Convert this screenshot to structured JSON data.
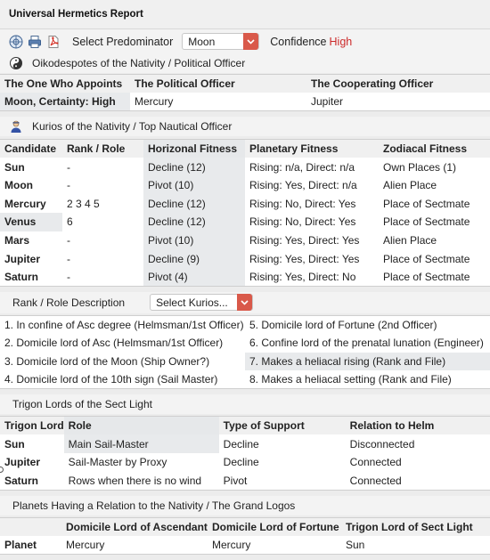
{
  "app": {
    "title": "Universal Hermetics Report"
  },
  "toolbar": {
    "predominator_label": "Select Predominator",
    "predominator_value": "Moon",
    "confidence_label": "Confidence",
    "confidence_value": "High"
  },
  "oikodespotes": {
    "heading": "Oikodespotes of the Nativity / Political Officer",
    "columns": [
      "The One Who Appoints",
      "The Political Officer",
      "The Cooperating Officer"
    ],
    "row": [
      "Moon, Certainty: High",
      "Mercury",
      "Jupiter"
    ]
  },
  "kurios": {
    "heading": "Kurios of the Nativity / Top Nautical Officer",
    "columns": [
      "Candidate",
      "Rank / Role",
      "Horizonal Fitness",
      "Planetary Fitness",
      "Zodiacal Fitness"
    ],
    "rows": [
      [
        "Sun",
        "-",
        "Decline (12)",
        "Rising: n/a, Direct: n/a",
        "Own Places (1)"
      ],
      [
        "Moon",
        "-",
        "Pivot (10)",
        "Rising: Yes, Direct: n/a",
        "Alien Place"
      ],
      [
        "Mercury",
        "2 3 4 5",
        "Decline (12)",
        "Rising: No, Direct: Yes",
        "Place of Sectmate"
      ],
      [
        "Venus",
        "6",
        "Decline (12)",
        "Rising: No, Direct: Yes",
        "Place of Sectmate"
      ],
      [
        "Mars",
        "-",
        "Pivot (10)",
        "Rising: Yes, Direct: Yes",
        "Alien Place"
      ],
      [
        "Jupiter",
        "-",
        "Decline (9)",
        "Rising: Yes, Direct: Yes",
        "Place of Sectmate"
      ],
      [
        "Saturn",
        "-",
        "Pivot (4)",
        "Rising: Yes, Direct: No",
        "Place of Sectmate"
      ]
    ]
  },
  "rank": {
    "heading": "Rank / Role Description",
    "select_value": "Select Kurios...",
    "items": [
      [
        "1. In confine of Asc degree (Helmsman/1st Officer)",
        "5. Domicile lord of Fortune (2nd Officer)"
      ],
      [
        "2. Domicile lord of Asc (Helmsman/1st Officer)",
        "6. Confine lord of the prenatal lunation (Engineer)"
      ],
      [
        "3. Domicile lord of the Moon (Ship Owner?)",
        "7. Makes a heliacal rising (Rank and File)"
      ],
      [
        "4. Domicile lord of the 10th sign (Sail Master)",
        "8. Makes a heliacal setting (Rank and File)"
      ]
    ]
  },
  "trigon": {
    "heading": "Trigon Lords of the Sect Light",
    "columns": [
      "Trigon Lord",
      "Role",
      "Type of Support",
      "Relation to Helm"
    ],
    "rows": [
      [
        "Sun",
        "Main Sail-Master",
        "Decline",
        "Disconnected"
      ],
      [
        "Jupiter",
        "Sail-Master by Proxy",
        "Decline",
        "Connected"
      ],
      [
        "Saturn",
        "Rows when there is no wind",
        "Pivot",
        "Connected"
      ]
    ]
  },
  "logos": {
    "heading": "Planets Having a Relation to the Nativity  / The Grand Logos",
    "columns": [
      "",
      "Domicile Lord of Ascendant",
      "Domicile Lord of Fortune",
      "Trigon Lord of Sect Light"
    ],
    "row": [
      "Planet",
      "Mercury",
      "Mercury",
      "Sun"
    ]
  }
}
